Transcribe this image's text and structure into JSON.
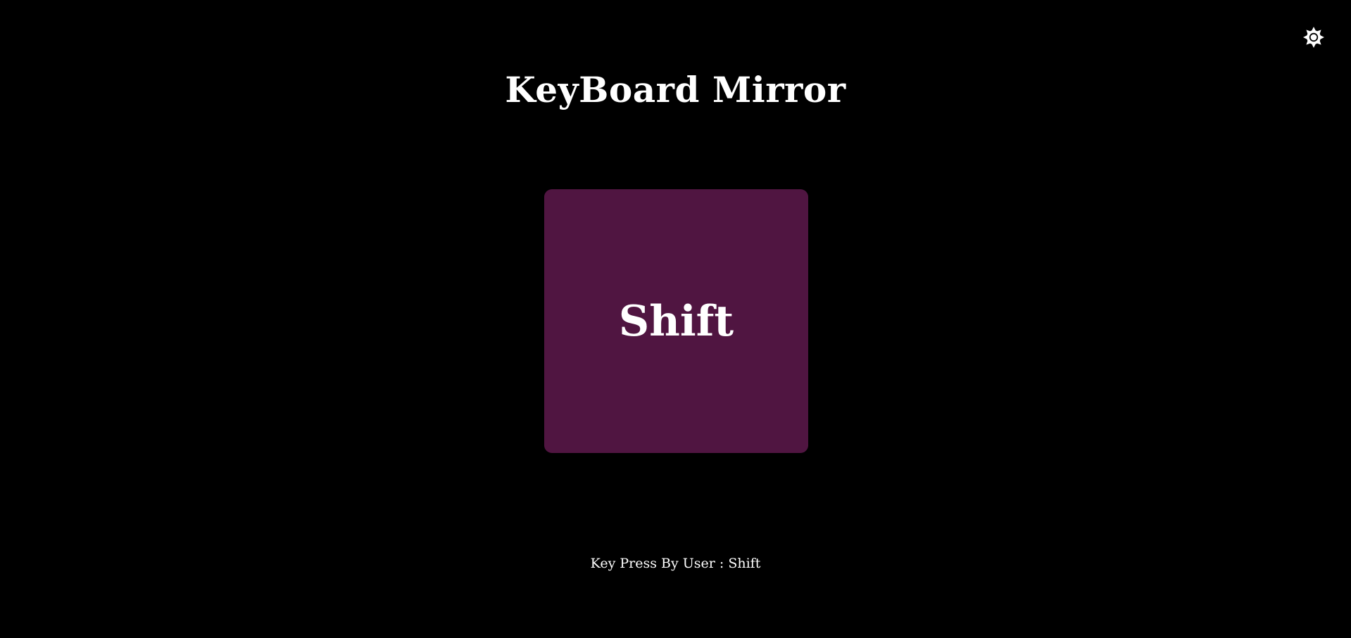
{
  "app": {
    "title": "KeyBoard Mirror"
  },
  "header": {
    "theme_toggle_icon": "sun-gear-icon"
  },
  "key_display": {
    "key": "Shift",
    "background_color": "#501541"
  },
  "status": {
    "prefix": "Key Press By User : ",
    "key": "Shift"
  },
  "colors": {
    "background": "#000000",
    "text": "#ffffff",
    "accent": "#501541"
  }
}
